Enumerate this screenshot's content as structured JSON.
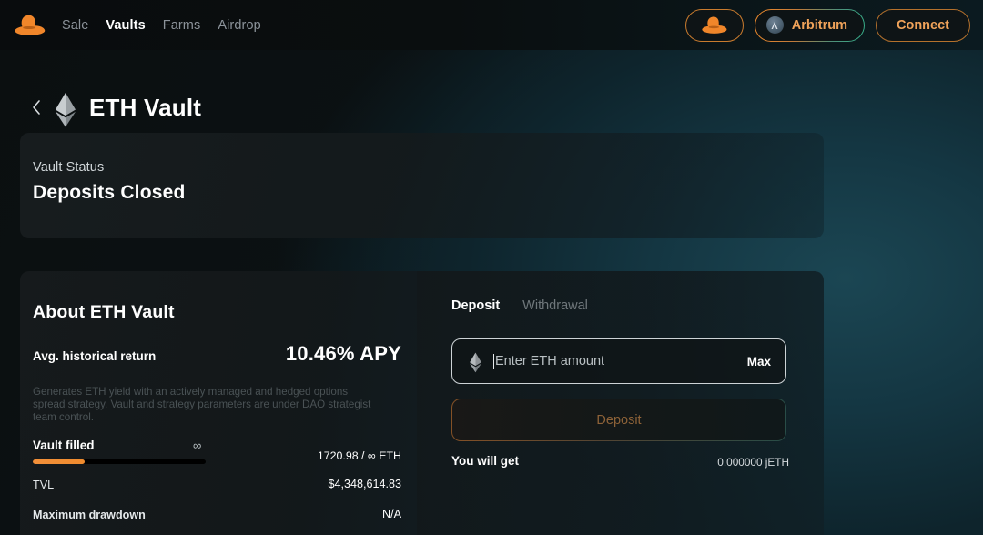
{
  "nav": {
    "logo_icon": "hat-logo-icon",
    "links": [
      {
        "label": "Sale",
        "active": false
      },
      {
        "label": "Vaults",
        "active": true
      },
      {
        "label": "Farms",
        "active": false
      },
      {
        "label": "Airdrop",
        "active": false
      }
    ],
    "hat_button_icon": "hat-icon",
    "chain": {
      "label": "Arbitrum",
      "icon": "arbitrum-icon"
    },
    "connect": {
      "label": "Connect"
    }
  },
  "header": {
    "back_icon": "chevron-left-icon",
    "asset_icon": "ethereum-icon",
    "title": "ETH Vault"
  },
  "status": {
    "label": "Vault Status",
    "value": "Deposits Closed"
  },
  "about": {
    "title": "About ETH Vault",
    "return_label": "Avg. historical return",
    "return_value": "10.46% APY",
    "description": "Generates ETH yield with an actively managed and hedged options spread strategy. Vault and strategy parameters are under DAO strategist team control.",
    "vault_filled_label": "Vault filled",
    "vault_filled_cap": "∞",
    "vault_filled_amount": "1720.98 / ∞ ETH",
    "vault_filled_percent": 30,
    "tvl_label": "TVL",
    "tvl_value": "$4,348,614.83",
    "drawdown_label": "Maximum drawdown",
    "drawdown_value": "N/A"
  },
  "deposit": {
    "tabs": [
      {
        "label": "Deposit",
        "active": true
      },
      {
        "label": "Withdrawal",
        "active": false
      }
    ],
    "input": {
      "icon": "ethereum-icon",
      "value": "",
      "placeholder": "Enter ETH amount",
      "max_label": "Max"
    },
    "action_label": "Deposit",
    "will_get_label": "You will get",
    "will_get_value": "0.000000 jETH"
  },
  "colors": {
    "accent_orange": "#f0a35a",
    "progress_orange": "#ef8b2e",
    "teal_glow": "#1b4653",
    "background": "#0b0f10"
  }
}
